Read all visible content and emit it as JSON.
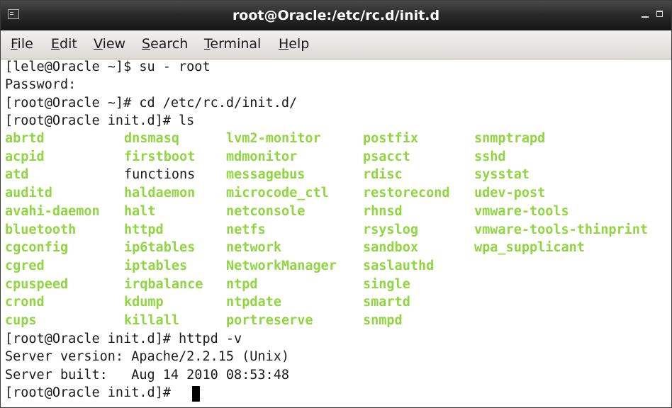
{
  "window": {
    "title": "root@Oracle:/etc/rc.d/init.d"
  },
  "menubar": {
    "items": [
      {
        "mnemonic": "F",
        "rest": "ile"
      },
      {
        "mnemonic": "E",
        "rest": "dit"
      },
      {
        "mnemonic": "V",
        "rest": "iew"
      },
      {
        "mnemonic": "S",
        "rest": "earch"
      },
      {
        "mnemonic": "T",
        "rest": "erminal"
      },
      {
        "mnemonic": "H",
        "rest": "elp"
      }
    ]
  },
  "terminal": {
    "lines_before": [
      "[lele@Oracle ~]$ su - root",
      "Password:",
      "[root@Oracle ~]# cd /etc/rc.d/init.d/",
      "[root@Oracle init.d]# ls"
    ],
    "ls_columns": [
      [
        "abrtd",
        "acpid",
        "atd",
        "auditd",
        "avahi-daemon",
        "bluetooth",
        "cgconfig",
        "cgred",
        "cpuspeed",
        "crond",
        "cups"
      ],
      [
        "dnsmasq",
        "firstboot",
        "functions",
        "haldaemon",
        "halt",
        "httpd",
        "ip6tables",
        "iptables",
        "irqbalance",
        "kdump",
        "killall"
      ],
      [
        "lvm2-monitor",
        "mdmonitor",
        "messagebus",
        "microcode_ctl",
        "netconsole",
        "netfs",
        "network",
        "NetworkManager",
        "ntpd",
        "ntpdate",
        "portreserve"
      ],
      [
        "postfix",
        "psacct",
        "rdisc",
        "restorecond",
        "rhnsd",
        "rsyslog",
        "sandbox",
        "saslauthd",
        "single",
        "smartd",
        "snmpd"
      ],
      [
        "snmptrapd",
        "sshd",
        "sysstat",
        "udev-post",
        "vmware-tools",
        "vmware-tools-thinprint",
        "wpa_supplicant"
      ]
    ],
    "non_executable_entries": [
      "functions"
    ],
    "lines_after": [
      "[root@Oracle init.d]# httpd -v",
      "Server version: Apache/2.2.15 (Unix)",
      "Server built:   Aug 14 2010 08:53:48",
      "[root@Oracle init.d]# "
    ],
    "executable_color": "#8fd640",
    "text_color": "#1a1a1a",
    "background_color": "#ffffff"
  }
}
